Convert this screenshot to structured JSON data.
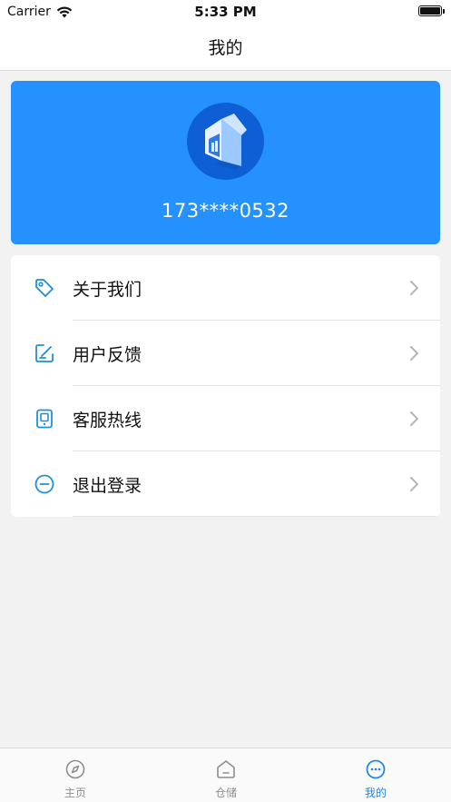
{
  "status_bar": {
    "carrier": "Carrier",
    "time": "5:33 PM"
  },
  "nav": {
    "title": "我的"
  },
  "profile": {
    "phone": "173****0532"
  },
  "menu": [
    {
      "label": "关于我们",
      "icon": "tag-icon"
    },
    {
      "label": "用户反馈",
      "icon": "edit-icon"
    },
    {
      "label": "客服热线",
      "icon": "phone-device-icon"
    },
    {
      "label": "退出登录",
      "icon": "minus-circle-icon"
    }
  ],
  "tabs": [
    {
      "label": "主页",
      "icon": "compass-icon",
      "active": false
    },
    {
      "label": "仓储",
      "icon": "house-icon",
      "active": false
    },
    {
      "label": "我的",
      "icon": "more-circle-icon",
      "active": true
    }
  ],
  "colors": {
    "accent": "#2491ff",
    "tab_active": "#2088e8",
    "icon_blue": "#1e8fe0"
  }
}
